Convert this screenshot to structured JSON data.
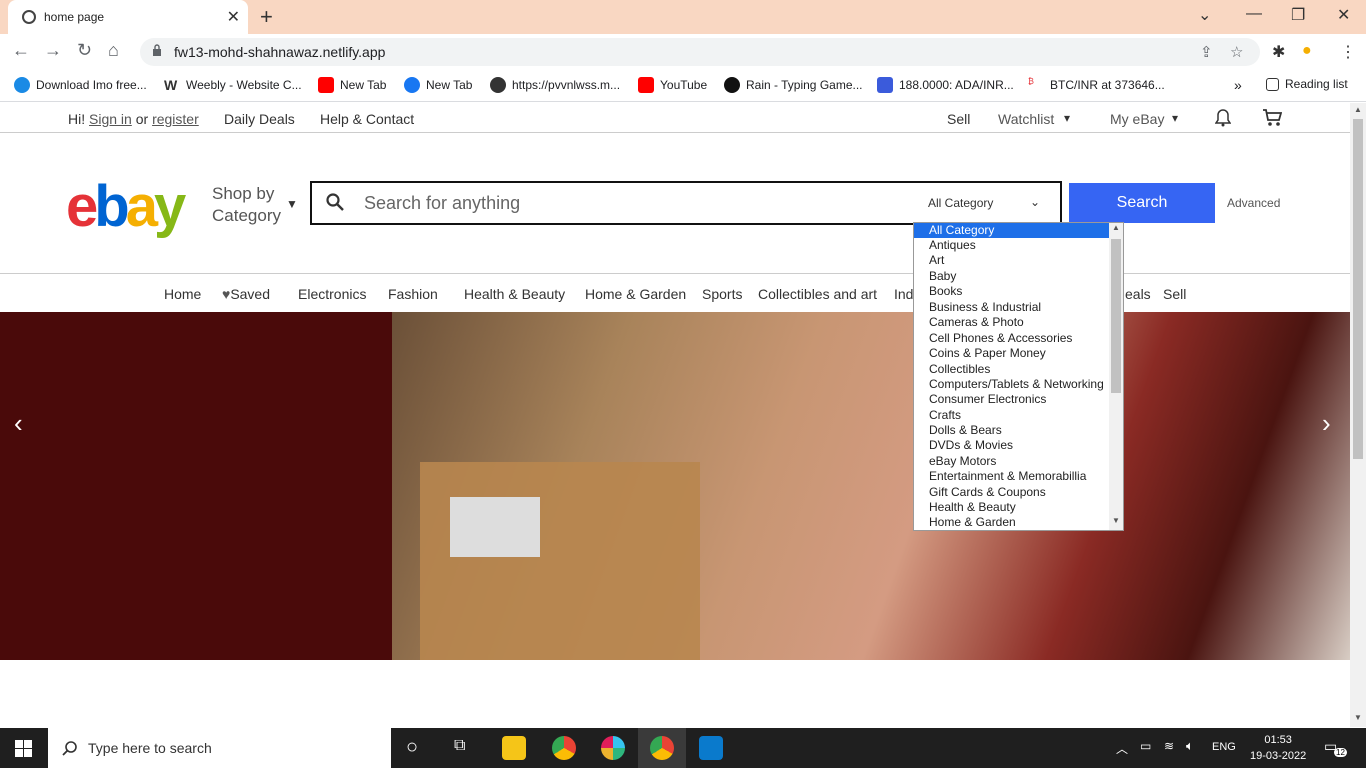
{
  "browser": {
    "tab_title": "home page",
    "url": "fw13-mohd-shahnawaz.netlify.app",
    "bookmarks": [
      "Download Imo free...",
      "Weebly - Website C...",
      "New Tab",
      "New Tab",
      "https://pvvnlwss.m...",
      "YouTube",
      "Rain - Typing Game...",
      "188.0000: ADA/INR...",
      "BTC/INR at 373646...",
      "Reading list"
    ]
  },
  "topbar": {
    "greeting": "Hi!",
    "sign_in": "Sign in",
    "or": "or",
    "register": "register",
    "daily_deals": "Daily Deals",
    "help": "Help & Contact",
    "sell": "Sell",
    "watchlist": "Watchlist",
    "my_ebay": "My eBay"
  },
  "header": {
    "logo": [
      "e",
      "b",
      "a",
      "y"
    ],
    "shop_by_1": "Shop by",
    "shop_by_2": "Category",
    "search_placeholder": "Search for anything",
    "category_selected": "All Category",
    "search_button": "Search",
    "advanced": "Advanced"
  },
  "catnav": [
    "Home",
    "Saved",
    "Electronics",
    "Fashion",
    "Health & Beauty",
    "Home & Garden",
    "Sports",
    "Collectibles and art",
    "Ind",
    "eals",
    "Sell"
  ],
  "dropdown": {
    "options": [
      "All Category",
      "Antiques",
      "Art",
      "Baby",
      "Books",
      "Business & Industrial",
      "Cameras & Photo",
      "Cell Phones & Accessories",
      "Coins & Paper Money",
      "Collectibles",
      "Computers/Tablets & Networking",
      "Consumer Electronics",
      "Crafts",
      "Dolls & Bears",
      "DVDs & Movies",
      "eBay Motors",
      "Entertainment & Memorabillia",
      "Gift Cards & Coupons",
      "Health & Beauty",
      "Home & Garden"
    ]
  },
  "taskbar": {
    "search_placeholder": "Type here to search",
    "lang": "ENG",
    "time": "01:53",
    "date": "19-03-2022",
    "notif_count": "12"
  },
  "colors": {
    "ebay_red": "#e53238",
    "ebay_blue": "#0064d2",
    "ebay_yellow": "#f5af02",
    "ebay_green": "#86b817",
    "search_button": "#3665f3"
  }
}
